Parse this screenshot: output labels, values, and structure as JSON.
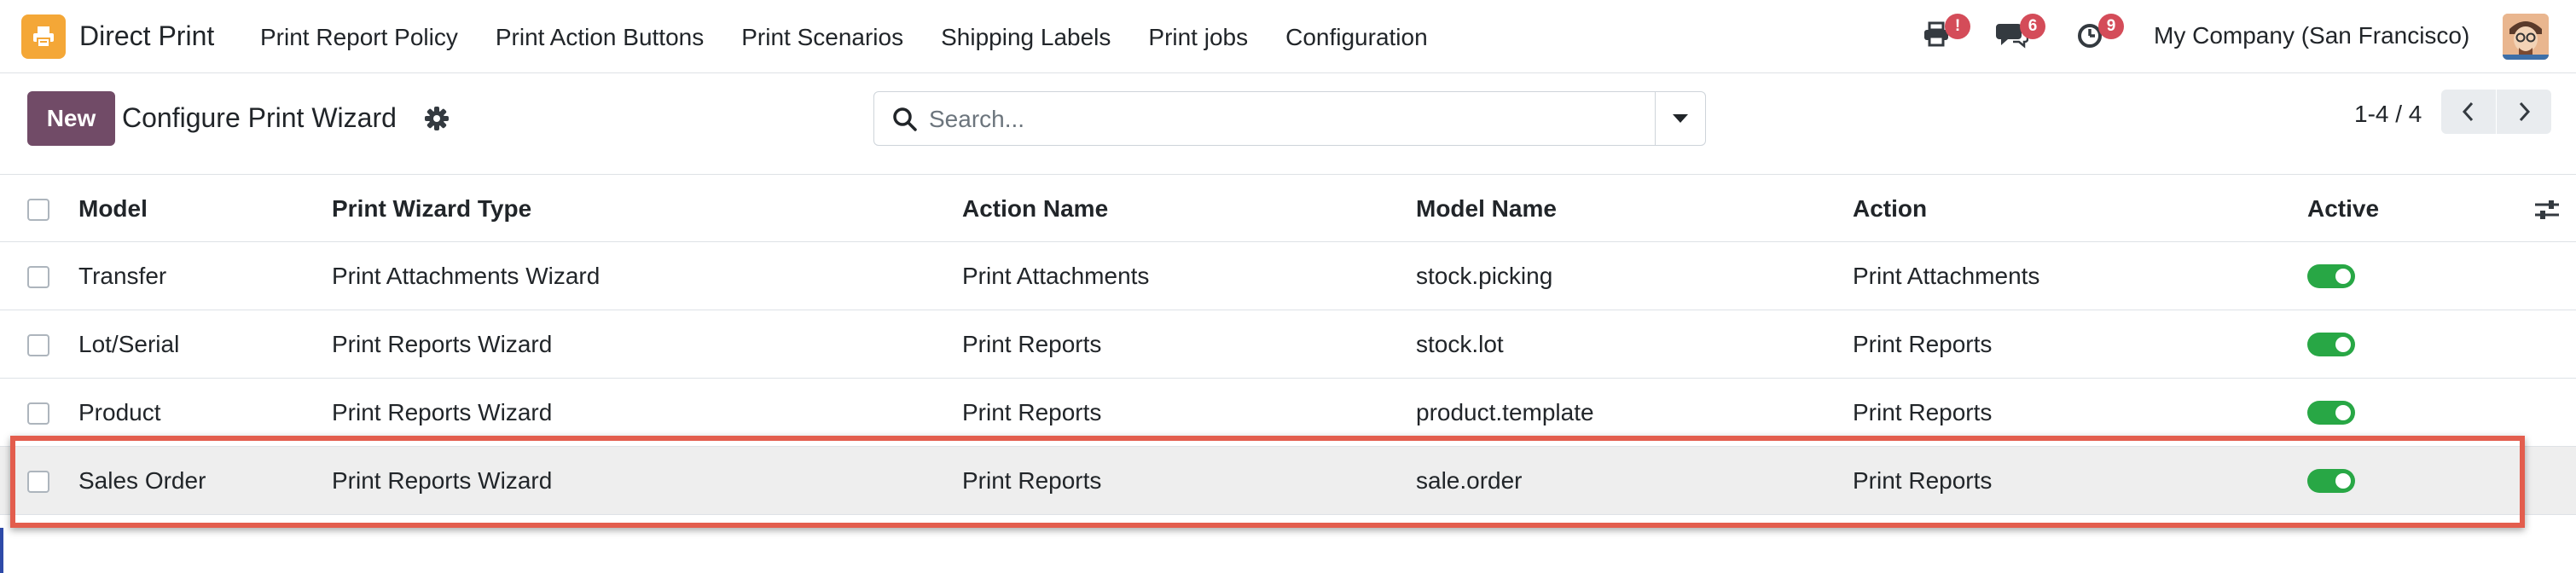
{
  "app": {
    "name": "Direct Print",
    "icon": "printer-app-icon",
    "accent": "#714b67"
  },
  "menu": [
    {
      "label": "Print Report Policy"
    },
    {
      "label": "Print Action Buttons"
    },
    {
      "label": "Print Scenarios"
    },
    {
      "label": "Shipping Labels"
    },
    {
      "label": "Print jobs"
    },
    {
      "label": "Configuration"
    }
  ],
  "systray": {
    "print_badge": "!",
    "messages_badge": "6",
    "activities_badge": "9",
    "company": "My Company (San Francisco)"
  },
  "control_panel": {
    "new_label": "New",
    "title": "Configure Print Wizard",
    "search_placeholder": "Search...",
    "pager_value": "1-4 / 4"
  },
  "table": {
    "columns": [
      "Model",
      "Print Wizard Type",
      "Action Name",
      "Model Name",
      "Action",
      "Active"
    ],
    "rows": [
      {
        "model": "Transfer",
        "wizard_type": "Print Attachments Wizard",
        "action_name": "Print Attachments",
        "model_name": "stock.picking",
        "action": "Print Attachments",
        "active": true
      },
      {
        "model": "Lot/Serial",
        "wizard_type": "Print Reports Wizard",
        "action_name": "Print Reports",
        "model_name": "stock.lot",
        "action": "Print Reports",
        "active": true
      },
      {
        "model": "Product",
        "wizard_type": "Print Reports Wizard",
        "action_name": "Print Reports",
        "model_name": "product.template",
        "action": "Print Reports",
        "active": true
      },
      {
        "model": "Sales Order",
        "wizard_type": "Print Reports Wizard",
        "action_name": "Print Reports",
        "model_name": "sale.order",
        "action": "Print Reports",
        "active": true
      }
    ],
    "highlighted_row": "Sales Order",
    "highlight_color": "#e35d4d",
    "toggle_color": "#28a745"
  }
}
